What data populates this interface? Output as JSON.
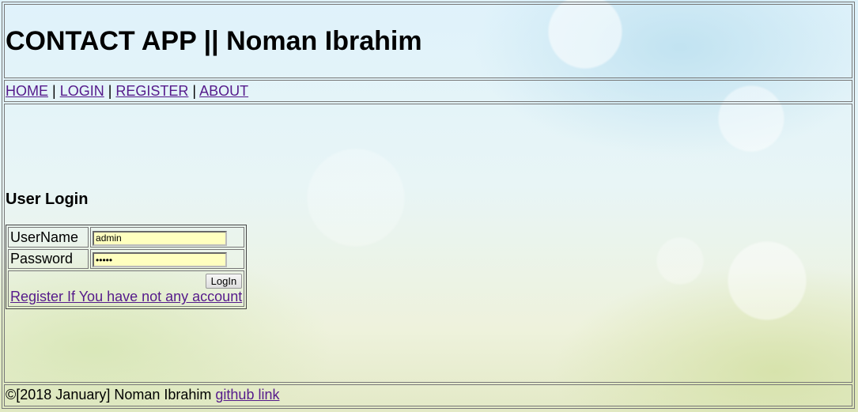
{
  "header": {
    "title": "CONTACT APP || Noman Ibrahim"
  },
  "nav": {
    "items": [
      {
        "label": "HOME"
      },
      {
        "label": "LOGIN"
      },
      {
        "label": "REGISTER"
      },
      {
        "label": "ABOUT"
      }
    ],
    "separator": " | "
  },
  "login": {
    "heading": "User Login",
    "username_label": "UserName",
    "username_value": "admin",
    "password_label": "Password",
    "password_value": "xxxxx",
    "submit_label": "LogIn",
    "register_link": "Register If You have not any account"
  },
  "footer": {
    "copyright": "©[2018 January] Noman Ibrahim ",
    "link_label": "github link"
  }
}
